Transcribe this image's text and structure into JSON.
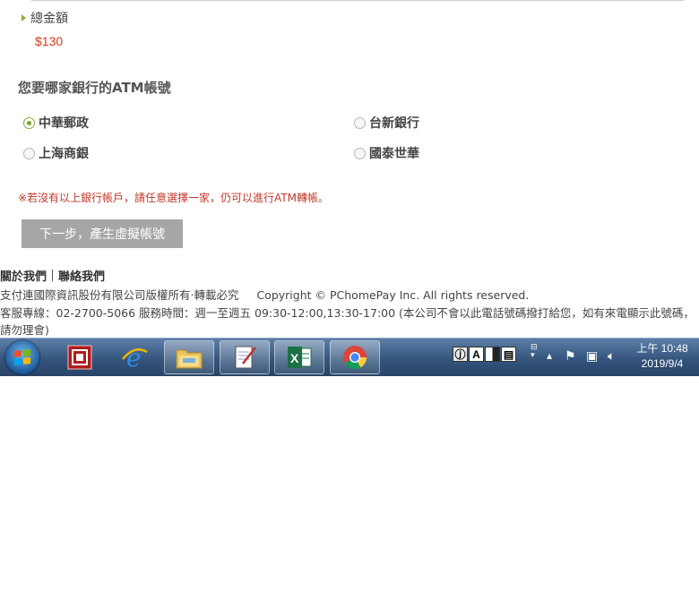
{
  "total": {
    "label": "總金額",
    "amount": "$130"
  },
  "bank_question": "您要哪家銀行的ATM帳號",
  "banks": [
    {
      "label": "中華郵政",
      "selected": true
    },
    {
      "label": "台新銀行",
      "selected": false
    },
    {
      "label": "上海商銀",
      "selected": false
    },
    {
      "label": "國泰世華",
      "selected": false
    }
  ],
  "note": "※若沒有以上銀行帳戶，請任意選擇一家，仍可以進行ATM轉帳。",
  "next_button": "下一步，產生虛擬帳號",
  "footer": {
    "about": "關於我們",
    "contact": "聯絡我們",
    "copyright_cn": "支付連國際資訊股份有限公司版權所有‧轉載必究",
    "copyright_en": "Copyright © PChomePay Inc. All rights reserved.",
    "service": "客服專線：02-2700-5066 服務時間：週一至週五 09:30-12:00,13:30-17:00 (本公司不會以此電話號碼撥打給您，如有來電顯示此號碼，請勿理會)"
  },
  "taskbar": {
    "apps": [
      "start-icon",
      "app-icon",
      "internet-explorer-icon",
      "file-explorer-icon",
      "notepad-icon",
      "excel-icon",
      "chrome-icon"
    ],
    "ime": [
      "A"
    ],
    "time": "上午 10:48",
    "date": "2019/9/4"
  },
  "colors": {
    "accent_green": "#7da32e",
    "price_red": "#d03a1a",
    "button_gray": "#a6a6a6"
  }
}
